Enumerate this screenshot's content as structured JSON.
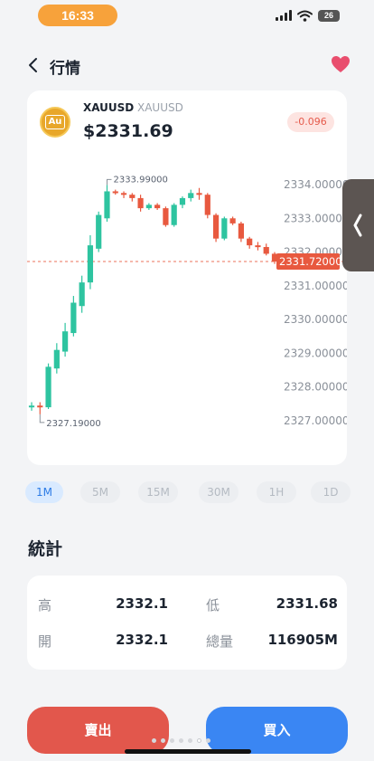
{
  "status": {
    "time": "16:33",
    "battery": "26"
  },
  "nav": {
    "title": "行情"
  },
  "symbol": {
    "name": "XAUUSD",
    "sub": "XAUUSD",
    "logo": "Au",
    "price": "$2331.69",
    "change": "-0.096"
  },
  "colors": {
    "up": "#2ec4a0",
    "down": "#e8593f",
    "accent": "#3a86f3",
    "sell": "#e2574c",
    "gold": "#e8a72a"
  },
  "chart_data": {
    "type": "candlestick",
    "y_ticks": [
      "2334.00000",
      "2333.00000",
      "2332.00000",
      "2331.00000",
      "2330.00000",
      "2329.00000",
      "2328.00000",
      "2327.00000"
    ],
    "ylim": [
      2327.0,
      2334.0
    ],
    "high_label": "2333.99000",
    "low_label": "2327.19000",
    "current_price_label": "2331.72000",
    "current_price": 2331.72,
    "candles": [
      {
        "o": 2327.4,
        "c": 2327.45,
        "h": 2327.55,
        "l": 2327.3
      },
      {
        "o": 2327.45,
        "c": 2327.4,
        "h": 2327.55,
        "l": 2327.19
      },
      {
        "o": 2327.4,
        "c": 2328.6,
        "h": 2328.7,
        "l": 2327.35
      },
      {
        "o": 2328.55,
        "c": 2329.1,
        "h": 2329.3,
        "l": 2328.4
      },
      {
        "o": 2329.05,
        "c": 2329.65,
        "h": 2329.9,
        "l": 2328.9
      },
      {
        "o": 2329.6,
        "c": 2330.5,
        "h": 2330.7,
        "l": 2329.5
      },
      {
        "o": 2330.4,
        "c": 2331.1,
        "h": 2331.3,
        "l": 2330.2
      },
      {
        "o": 2331.1,
        "c": 2332.2,
        "h": 2332.5,
        "l": 2330.9
      },
      {
        "o": 2332.1,
        "c": 2333.1,
        "h": 2333.2,
        "l": 2332.0
      },
      {
        "o": 2333.0,
        "c": 2333.8,
        "h": 2333.99,
        "l": 2332.9
      },
      {
        "o": 2333.8,
        "c": 2333.75,
        "h": 2333.85,
        "l": 2333.7
      },
      {
        "o": 2333.75,
        "c": 2333.7,
        "h": 2333.8,
        "l": 2333.6
      },
      {
        "o": 2333.7,
        "c": 2333.6,
        "h": 2333.75,
        "l": 2333.5
      },
      {
        "o": 2333.6,
        "c": 2333.3,
        "h": 2333.7,
        "l": 2333.2
      },
      {
        "o": 2333.3,
        "c": 2333.4,
        "h": 2333.45,
        "l": 2333.25
      },
      {
        "o": 2333.4,
        "c": 2333.3,
        "h": 2333.45,
        "l": 2333.25
      },
      {
        "o": 2333.3,
        "c": 2332.8,
        "h": 2333.35,
        "l": 2332.75
      },
      {
        "o": 2332.8,
        "c": 2333.4,
        "h": 2333.45,
        "l": 2332.75
      },
      {
        "o": 2333.4,
        "c": 2333.6,
        "h": 2333.65,
        "l": 2333.3
      },
      {
        "o": 2333.6,
        "c": 2333.75,
        "h": 2333.85,
        "l": 2333.5
      },
      {
        "o": 2333.75,
        "c": 2333.7,
        "h": 2333.9,
        "l": 2333.55
      },
      {
        "o": 2333.7,
        "c": 2333.1,
        "h": 2333.75,
        "l": 2333.0
      },
      {
        "o": 2333.1,
        "c": 2332.4,
        "h": 2333.15,
        "l": 2332.3
      },
      {
        "o": 2332.4,
        "c": 2333.0,
        "h": 2333.05,
        "l": 2332.35
      },
      {
        "o": 2333.0,
        "c": 2332.85,
        "h": 2333.05,
        "l": 2332.8
      },
      {
        "o": 2332.85,
        "c": 2332.4,
        "h": 2332.9,
        "l": 2332.3
      },
      {
        "o": 2332.4,
        "c": 2332.2,
        "h": 2332.45,
        "l": 2332.1
      },
      {
        "o": 2332.2,
        "c": 2332.15,
        "h": 2332.3,
        "l": 2332.05
      },
      {
        "o": 2332.15,
        "c": 2331.95,
        "h": 2332.25,
        "l": 2331.9
      },
      {
        "o": 2331.95,
        "c": 2331.72,
        "h": 2332.0,
        "l": 2331.65
      }
    ]
  },
  "timeframes": [
    {
      "label": "1M",
      "active": true
    },
    {
      "label": "5M",
      "active": false
    },
    {
      "label": "15M",
      "active": false
    },
    {
      "label": "30M",
      "active": false
    },
    {
      "label": "1H",
      "active": false
    },
    {
      "label": "1D",
      "active": false
    }
  ],
  "stats": {
    "title": "統計",
    "high_label": "高",
    "high_value": "2332.1",
    "low_label": "低",
    "low_value": "2331.68",
    "open_label": "開",
    "open_value": "2332.1",
    "volume_label": "總量",
    "volume_value": "116905M"
  },
  "actions": {
    "sell": "賣出",
    "buy": "買入"
  }
}
